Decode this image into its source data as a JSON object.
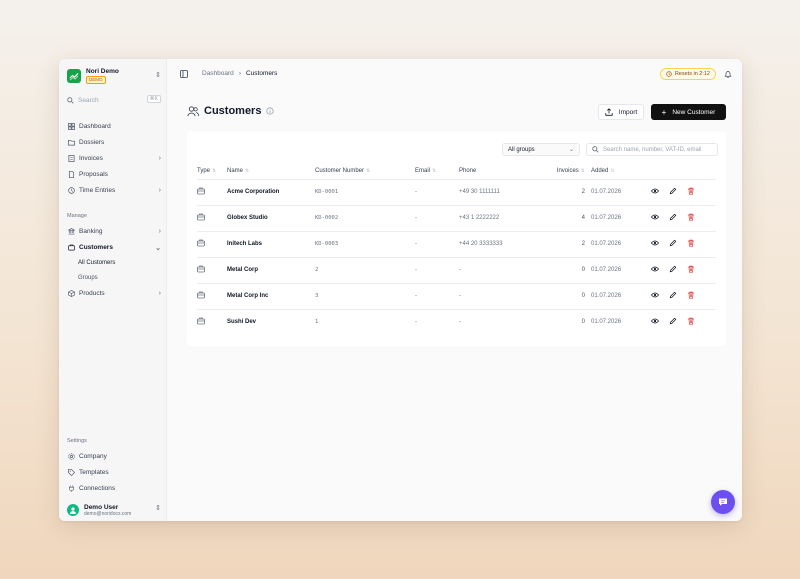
{
  "brand": {
    "name": "Nori Demo",
    "badge": "DEMO"
  },
  "search": {
    "label": "Search",
    "shortcut": "⌘K"
  },
  "nav": {
    "items": [
      {
        "label": "Dashboard",
        "icon": "dashboard-icon"
      },
      {
        "label": "Dossiers",
        "icon": "folder-icon"
      },
      {
        "label": "Invoices",
        "icon": "invoice-icon"
      },
      {
        "label": "Proposals",
        "icon": "document-icon"
      },
      {
        "label": "Time Entries",
        "icon": "clock-icon"
      }
    ],
    "manage_label": "Manage",
    "manage_items": [
      {
        "label": "Banking",
        "icon": "bank-icon"
      },
      {
        "label": "Customers",
        "icon": "users-icon"
      },
      {
        "label": "Products",
        "icon": "box-icon"
      }
    ],
    "customers_sub": [
      "All Customers",
      "Groups"
    ],
    "settings_label": "Settings",
    "settings_items": [
      {
        "label": "Company",
        "icon": "gear-icon"
      },
      {
        "label": "Templates",
        "icon": "tag-icon"
      },
      {
        "label": "Connections",
        "icon": "plug-icon"
      }
    ]
  },
  "user": {
    "name": "Demo User",
    "email": "demo@noridocs.com"
  },
  "topbar": {
    "breadcrumb": [
      "Dashboard",
      "Customers"
    ],
    "reset_label": "Resets in 2:12"
  },
  "page": {
    "title": "Customers",
    "import_label": "Import",
    "new_label": "New Customer"
  },
  "filters": {
    "group_value": "All groups",
    "search_placeholder": "Search name, number, VAT-ID, email"
  },
  "table": {
    "columns": [
      "Type",
      "Name",
      "Customer Number",
      "Email",
      "Phone",
      "Invoices",
      "Added"
    ],
    "rows": [
      {
        "name": "Acme Corporation",
        "number": "KD-0001",
        "email": "-",
        "phone": "+49 30 1111111",
        "invoices": "2",
        "added": "01.07.2026"
      },
      {
        "name": "Globex Studio",
        "number": "KD-0002",
        "email": "-",
        "phone": "+43 1 2222222",
        "invoices": "4",
        "added": "01.07.2026"
      },
      {
        "name": "Initech Labs",
        "number": "KD-0003",
        "email": "-",
        "phone": "+44 20 3333333",
        "invoices": "2",
        "added": "01.07.2026"
      },
      {
        "name": "Metal Corp",
        "number": "2",
        "email": "-",
        "phone": "-",
        "invoices": "0",
        "added": "01.07.2026"
      },
      {
        "name": "Metal Corp Inc",
        "number": "3",
        "email": "-",
        "phone": "-",
        "invoices": "0",
        "added": "01.07.2026"
      },
      {
        "name": "Sushi Dev",
        "number": "1",
        "email": "-",
        "phone": "-",
        "invoices": "0",
        "added": "01.07.2026"
      }
    ]
  },
  "colors": {
    "accent": "#16a34a",
    "primary_button": "#111111",
    "delete": "#dc2626",
    "chat": "#6d4ff0"
  }
}
